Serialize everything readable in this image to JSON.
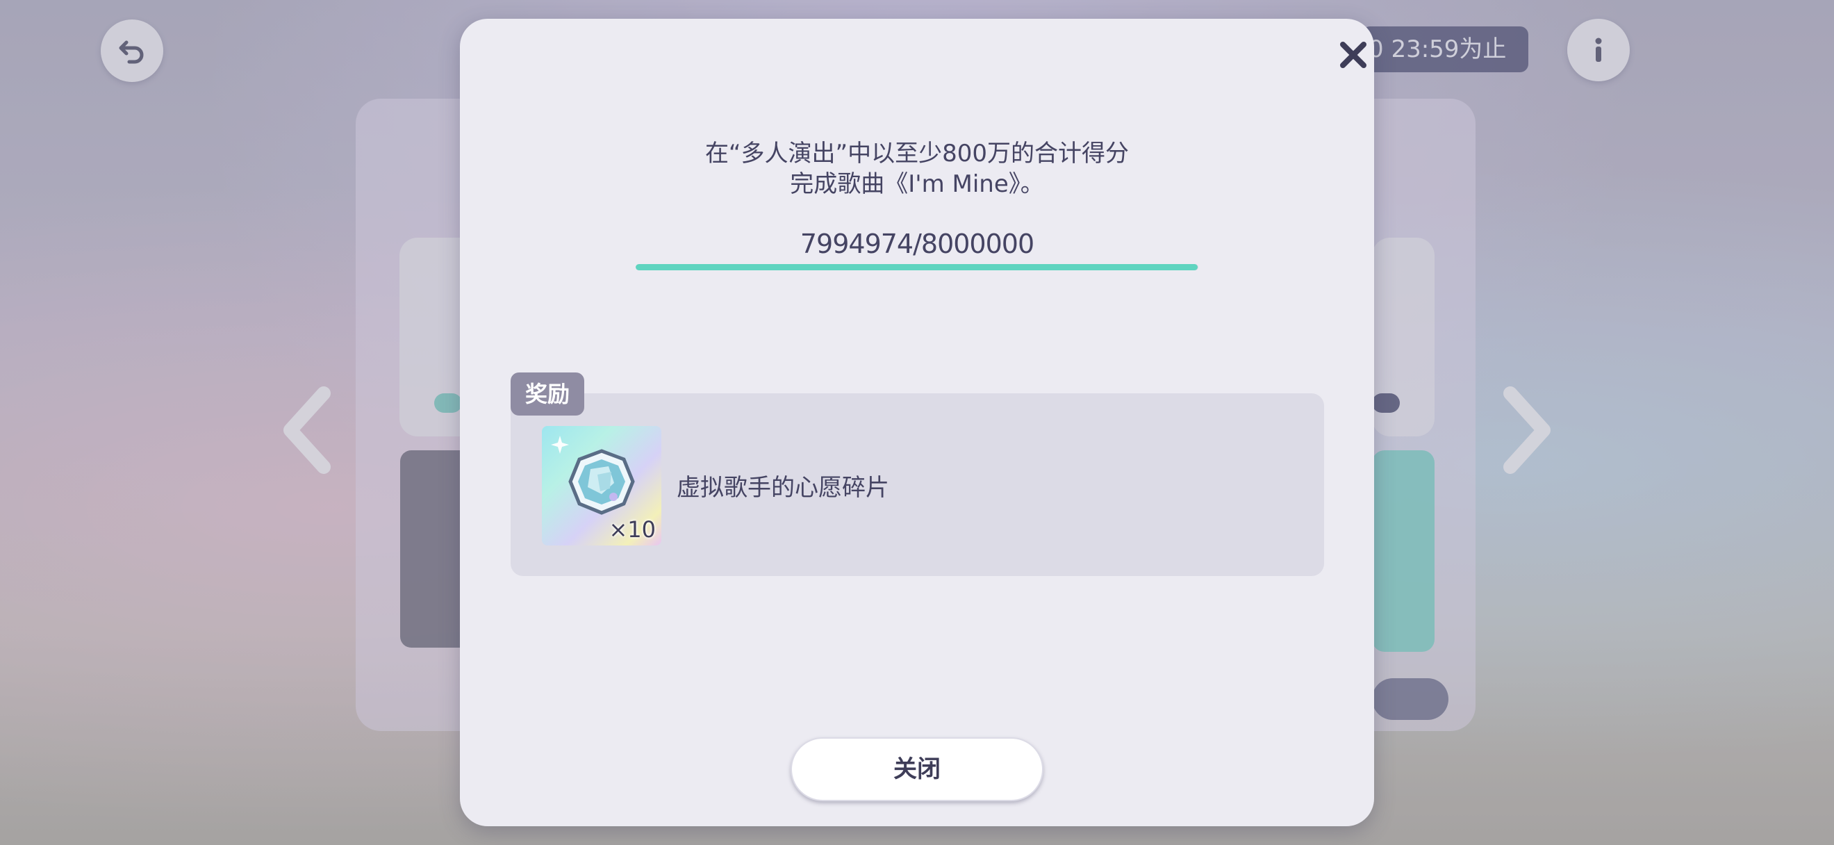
{
  "background": {
    "deadline_text": "0 23:59为止"
  },
  "modal": {
    "description_line1": "在“多人演出”中以至少800万的合计得分",
    "description_line2": "完成歌曲《I'm Mine》。",
    "progress": {
      "text": "7994974/8000000",
      "current": 7994974,
      "target": 8000000,
      "fill_color": "#5fd4c0"
    },
    "reward": {
      "tag": "奖励",
      "item_name": "虚拟歌手的心愿碎片",
      "quantity": "×10",
      "icon": "wish-fragment-icon"
    },
    "close_button_label": "关闭"
  }
}
